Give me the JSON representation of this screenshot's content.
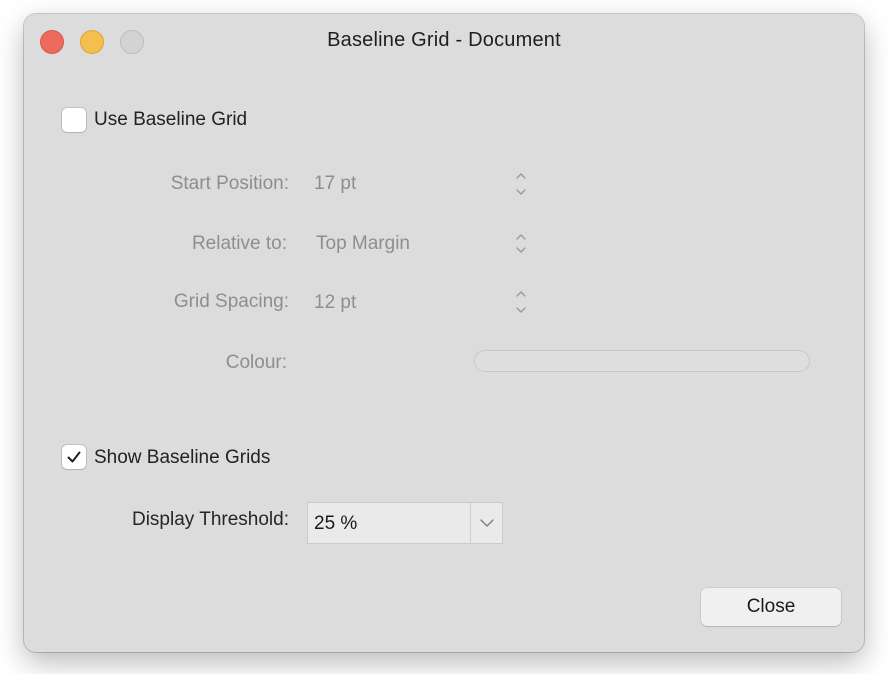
{
  "window": {
    "title": "Baseline Grid - Document"
  },
  "use_baseline_grid": {
    "label": "Use Baseline Grid",
    "checked": false
  },
  "fields": {
    "start_position": {
      "label": "Start Position:",
      "value": "17 pt"
    },
    "relative_to": {
      "label": "Relative to:",
      "value": "Top Margin"
    },
    "grid_spacing": {
      "label": "Grid Spacing:",
      "value": "12 pt"
    },
    "colour": {
      "label": "Colour:"
    }
  },
  "show_baseline_grids": {
    "label": "Show Baseline Grids",
    "checked": true
  },
  "display_threshold": {
    "label": "Display Threshold:",
    "value": "25 %"
  },
  "buttons": {
    "close": "Close"
  },
  "colors": {
    "window_bg": "#dcdcdc",
    "close_light": "#ed6a5e",
    "minimize_light": "#f5bf4f",
    "zoom_light": "#d3d3d3",
    "disabled_text": "#8e8e8e"
  },
  "icons": {
    "checkmark": "checkmark-icon",
    "stepper": "stepper-arrows-icon",
    "chevron": "chevron-down-icon"
  }
}
